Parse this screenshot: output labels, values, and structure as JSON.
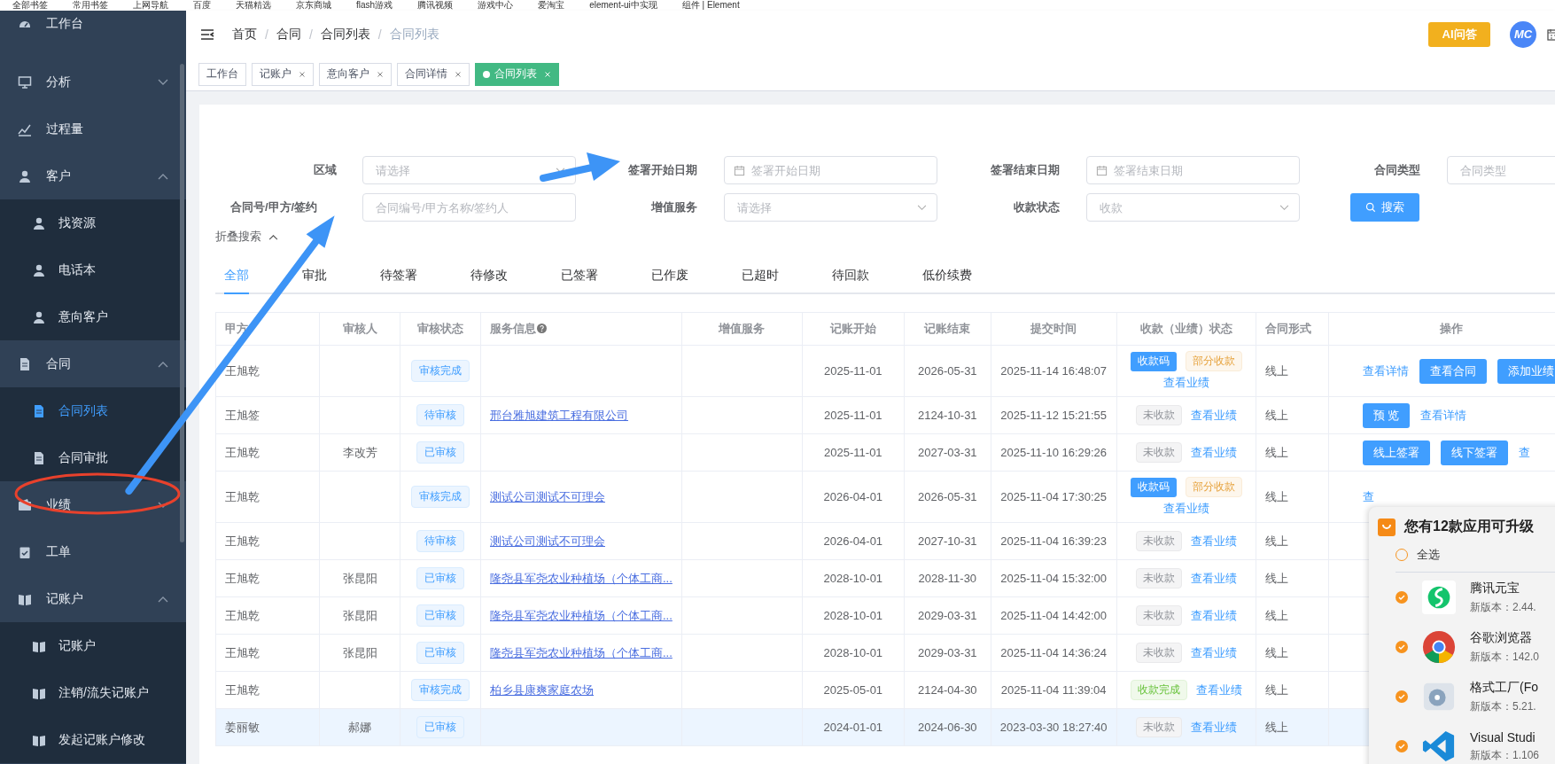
{
  "bookmarks": [
    {
      "label": "全部书签"
    },
    {
      "label": "常用书签"
    },
    {
      "label": "上网导航"
    },
    {
      "label": "百度"
    },
    {
      "label": "天猫精选"
    },
    {
      "label": "京东商城"
    },
    {
      "label": "flash游戏"
    },
    {
      "label": "腾讯视频"
    },
    {
      "label": "游戏中心"
    },
    {
      "label": "爱淘宝"
    },
    {
      "label": "element-ui中实现"
    },
    {
      "label": "组件 | Element"
    }
  ],
  "sidebar": {
    "items": [
      {
        "label": "工作台"
      },
      {
        "label": "分析",
        "expanded": false
      },
      {
        "label": "过程量"
      },
      {
        "label": "客户",
        "expanded": true,
        "children": [
          {
            "label": "找资源",
            "selected": false
          },
          {
            "label": "电话本",
            "selected": false
          },
          {
            "label": "意向客户",
            "selected": false
          }
        ]
      },
      {
        "label": "合同",
        "expanded": true,
        "children": [
          {
            "label": "合同列表",
            "selected": true
          },
          {
            "label": "合同审批",
            "selected": false
          }
        ]
      },
      {
        "label": "业绩",
        "expanded": false
      },
      {
        "label": "工单"
      },
      {
        "label": "记账户",
        "expanded": true,
        "children": [
          {
            "label": "记账户",
            "selected": false
          },
          {
            "label": "注销/流失记账户",
            "selected": false
          },
          {
            "label": "发起记账户修改",
            "selected": false
          }
        ]
      }
    ]
  },
  "header": {
    "breadcrumb": [
      "首页",
      "合同",
      "合同列表",
      "合同列表"
    ],
    "breadcrumb_separator": "/",
    "ai_button": "AI问答",
    "avatar": "MC"
  },
  "tags": [
    {
      "label": "工作台",
      "selected": false,
      "closable": false
    },
    {
      "label": "记账户",
      "selected": false,
      "closable": true
    },
    {
      "label": "意向客户",
      "selected": false,
      "closable": true
    },
    {
      "label": "合同详情",
      "selected": false,
      "closable": true
    },
    {
      "label": "合同列表",
      "selected": true,
      "closable": true
    }
  ],
  "filters": {
    "rows": [
      [
        {
          "label": "区域",
          "kind": "select",
          "placeholder": "请选择"
        },
        {
          "label": "签署开始日期",
          "kind": "date",
          "placeholder": "签署开始日期"
        },
        {
          "label": "签署结束日期",
          "kind": "date",
          "placeholder": "签署结束日期"
        },
        {
          "label": "合同类型",
          "kind": "input",
          "placeholder": "合同类型"
        }
      ],
      [
        {
          "label": "合同号/甲方/签约",
          "kind": "input",
          "placeholder": "合同编号/甲方名称/签约人"
        },
        {
          "label": "增值服务",
          "kind": "select",
          "placeholder": "请选择"
        },
        {
          "label": "收款状态",
          "kind": "select",
          "placeholder": "收款"
        }
      ]
    ],
    "search_button": "搜索",
    "collapse": "折叠搜索"
  },
  "status_tabs": [
    {
      "label": "全部",
      "selected": true
    },
    {
      "label": "审批",
      "selected": false
    },
    {
      "label": "待签署",
      "selected": false
    },
    {
      "label": "待修改",
      "selected": false
    },
    {
      "label": "已签署",
      "selected": false
    },
    {
      "label": "已作废",
      "selected": false
    },
    {
      "label": "已超时",
      "selected": false
    },
    {
      "label": "待回款",
      "selected": false
    },
    {
      "label": "低价续费",
      "selected": false
    }
  ],
  "table": {
    "columns": [
      {
        "label": "甲方"
      },
      {
        "label": "审核人"
      },
      {
        "label": "审核状态"
      },
      {
        "label": "服务信息",
        "help": true
      },
      {
        "label": "增值服务"
      },
      {
        "label": "记账开始"
      },
      {
        "label": "记账结束"
      },
      {
        "label": "提交时间"
      },
      {
        "label": "收款（业绩）状态"
      },
      {
        "label": "合同形式"
      },
      {
        "label": "操作"
      }
    ],
    "rows": [
      {
        "selected": false,
        "party": "王旭乾",
        "reviewer": "",
        "status": "审核完成",
        "service": "",
        "start": "2025-11-01",
        "end": "2026-05-31",
        "submitted": "2025-11-14 16:48:07",
        "payment": [
          {
            "kind": "button",
            "label": "收款码"
          },
          {
            "kind": "warning-tag",
            "label": "部分收款"
          },
          {
            "kind": "link",
            "label": "查看业绩"
          }
        ],
        "form": "线上",
        "actions": [
          {
            "kind": "link",
            "label": "查看详情"
          },
          {
            "kind": "button",
            "label": "查看合同"
          },
          {
            "kind": "button",
            "label": "添加业绩"
          }
        ]
      },
      {
        "selected": false,
        "party": "王旭签",
        "reviewer": "",
        "status": "待审核",
        "service": "邢台雅旭建筑工程有限公司",
        "start": "2025-11-01",
        "end": "2124-10-31",
        "submitted": "2025-11-12 15:21:55",
        "payment": [
          {
            "kind": "info-tag",
            "label": "未收款"
          },
          {
            "kind": "link",
            "label": "查看业绩"
          }
        ],
        "form": "线上",
        "actions": [
          {
            "kind": "button",
            "label": "预 览"
          },
          {
            "kind": "link",
            "label": "查看详情"
          }
        ]
      },
      {
        "selected": false,
        "party": "王旭乾",
        "reviewer": "李改芳",
        "status": "已审核",
        "service": "",
        "start": "2025-11-01",
        "end": "2027-03-31",
        "submitted": "2025-11-10 16:29:26",
        "payment": [
          {
            "kind": "info-tag",
            "label": "未收款"
          },
          {
            "kind": "link",
            "label": "查看业绩"
          }
        ],
        "form": "线上",
        "actions": [
          {
            "kind": "button",
            "label": "线上签署"
          },
          {
            "kind": "button",
            "label": "线下签署"
          },
          {
            "kind": "link",
            "label": "查"
          }
        ]
      },
      {
        "selected": false,
        "party": "王旭乾",
        "reviewer": "",
        "status": "审核完成",
        "service": "测试公司测试不可理会",
        "start": "2026-04-01",
        "end": "2026-05-31",
        "submitted": "2025-11-04 17:30:25",
        "payment": [
          {
            "kind": "button",
            "label": "收款码"
          },
          {
            "kind": "warning-tag",
            "label": "部分收款"
          },
          {
            "kind": "link",
            "label": "查看业绩"
          }
        ],
        "form": "线上",
        "actions": [
          {
            "kind": "link",
            "label": "查"
          }
        ]
      },
      {
        "selected": false,
        "party": "王旭乾",
        "reviewer": "",
        "status": "待审核",
        "service": "测试公司测试不可理会",
        "start": "2026-04-01",
        "end": "2027-10-31",
        "submitted": "2025-11-04 16:39:23",
        "payment": [
          {
            "kind": "info-tag",
            "label": "未收款"
          },
          {
            "kind": "link",
            "label": "查看业绩"
          }
        ],
        "form": "线上"
      },
      {
        "selected": false,
        "party": "王旭乾",
        "reviewer": "张昆阳",
        "status": "已审核",
        "service": "隆尧县军尧农业种植场（个体工商...",
        "start": "2028-10-01",
        "end": "2028-11-30",
        "submitted": "2025-11-04 15:32:00",
        "payment": [
          {
            "kind": "info-tag",
            "label": "未收款"
          },
          {
            "kind": "link",
            "label": "查看业绩"
          }
        ],
        "form": "线上"
      },
      {
        "selected": false,
        "party": "王旭乾",
        "reviewer": "张昆阳",
        "status": "已审核",
        "service": "隆尧县军尧农业种植场（个体工商...",
        "start": "2028-10-01",
        "end": "2029-03-31",
        "submitted": "2025-11-04 14:42:00",
        "payment": [
          {
            "kind": "info-tag",
            "label": "未收款"
          },
          {
            "kind": "link",
            "label": "查看业绩"
          }
        ],
        "form": "线上"
      },
      {
        "selected": false,
        "party": "王旭乾",
        "reviewer": "张昆阳",
        "status": "已审核",
        "service": "隆尧县军尧农业种植场（个体工商...",
        "start": "2028-10-01",
        "end": "2029-03-31",
        "submitted": "2025-11-04 14:36:24",
        "payment": [
          {
            "kind": "info-tag",
            "label": "未收款"
          },
          {
            "kind": "link",
            "label": "查看业绩"
          }
        ],
        "form": "线上"
      },
      {
        "selected": false,
        "party": "王旭乾",
        "reviewer": "",
        "status": "审核完成",
        "service": "柏乡县康爽家庭农场",
        "start": "2025-05-01",
        "end": "2124-04-30",
        "submitted": "2025-11-04 11:39:04",
        "payment": [
          {
            "kind": "success-tag",
            "label": "收款完成"
          },
          {
            "kind": "link",
            "label": "查看业绩"
          }
        ],
        "form": "线上"
      },
      {
        "selected": true,
        "party": "姜丽敏",
        "reviewer": "郝娜",
        "status": "已审核",
        "service": "",
        "start": "2024-01-01",
        "end": "2024-06-30",
        "submitted": "2023-03-30 18:27:40",
        "payment": [
          {
            "kind": "info-tag",
            "label": "未收款"
          },
          {
            "kind": "link",
            "label": "查看业绩"
          }
        ],
        "form": "线上"
      }
    ]
  },
  "update_popup": {
    "title": "您有12款应用可升级",
    "select_all": {
      "label": "全选",
      "checked": false
    },
    "apps": [
      {
        "name": "腾讯元宝",
        "version": "新版本：2.44.",
        "checked": true
      },
      {
        "name": "谷歌浏览器",
        "version": "新版本：142.0",
        "checked": true
      },
      {
        "name": "格式工厂(Fo",
        "version": "新版本：5.21.",
        "checked": true
      },
      {
        "name": "Visual Studi",
        "version": "新版本：1.106",
        "checked": true
      }
    ]
  }
}
